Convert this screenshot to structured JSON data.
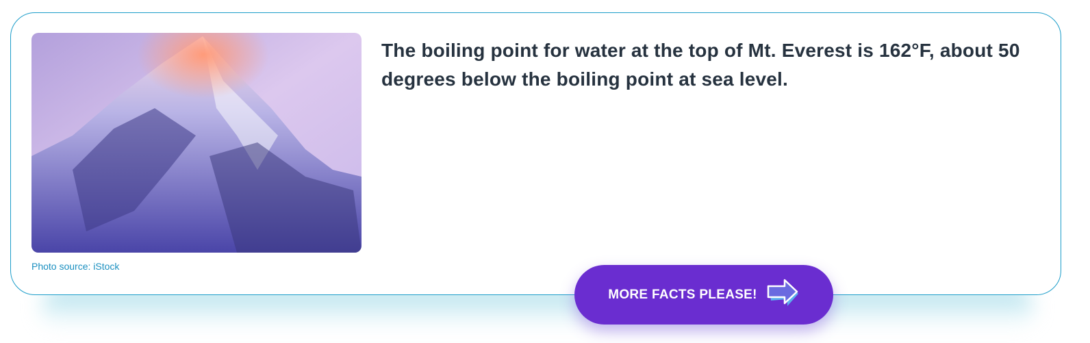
{
  "fact": {
    "text": "The boiling point for water at the top of Mt. Everest is 162°F, about 50 degrees below the boiling point at sea level.",
    "photo_caption": "Photo source: iStock"
  },
  "button": {
    "label": "MORE FACTS PLEASE!",
    "icon": "arrow-right-icon"
  },
  "colors": {
    "border": "#1a9cc9",
    "button": "#6a2dd0",
    "caption": "#1a8fc0",
    "text": "#26323f"
  }
}
